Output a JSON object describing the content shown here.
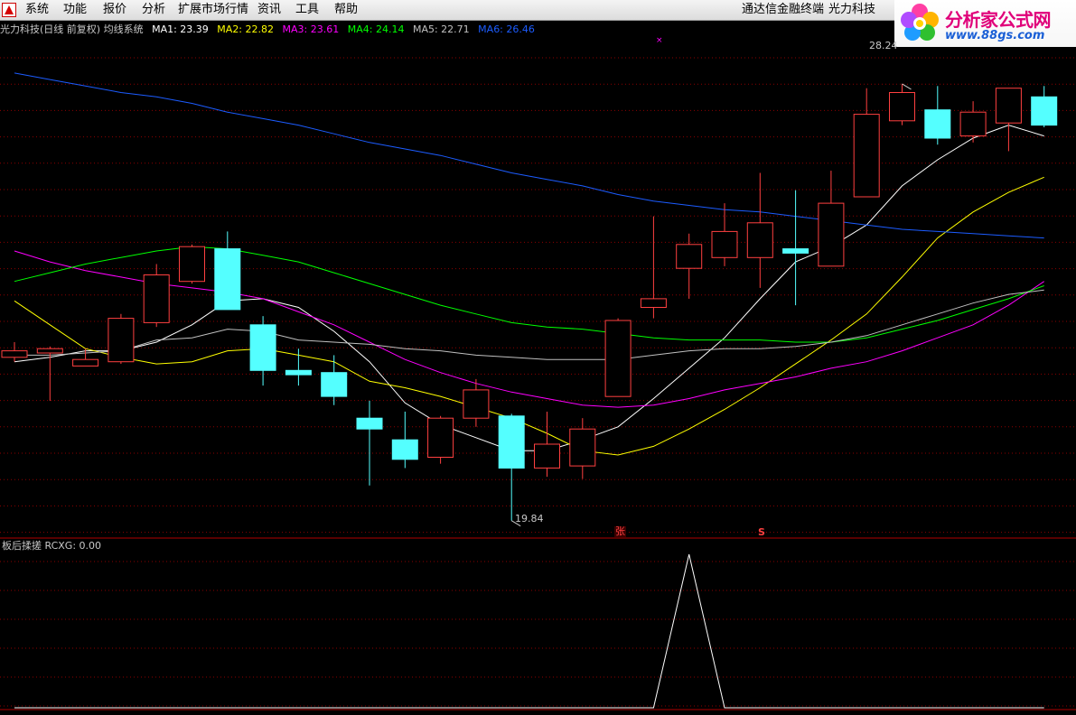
{
  "menu": {
    "items": [
      "系统",
      "功能",
      "报价",
      "分析",
      "扩展市场行情",
      "资讯",
      "工具",
      "帮助"
    ],
    "right_items": [
      "通达信金融终端",
      "光力科技"
    ]
  },
  "logo": {
    "title": "分析家公式网",
    "url": "www.88gs.com"
  },
  "info": {
    "stock": "光力科技(日线 前复权) 均线系统",
    "ma": [
      {
        "label": "MA1: 23.39",
        "color": "#ffffff"
      },
      {
        "label": "MA2: 22.82",
        "color": "#ffff00"
      },
      {
        "label": "MA3: 23.61",
        "color": "#ff00ff"
      },
      {
        "label": "MA4: 24.14",
        "color": "#00ff00"
      },
      {
        "label": "MA5: 22.71",
        "color": "#c0c0c0"
      },
      {
        "label": "MA6: 26.46",
        "color": "#1c5cff"
      }
    ]
  },
  "price_markers": {
    "high": "28.24",
    "low": "19.84"
  },
  "signals": {
    "zhang": "张",
    "s": "S"
  },
  "sub_indicator": {
    "label": "板后揉搓 RCXG: 0.00"
  },
  "colors": {
    "up": "#ff4040",
    "down": "#54ffff",
    "grid": "#8b0000",
    "background": "#000000"
  },
  "chart_data": {
    "type": "candlestick",
    "candles": [
      {
        "o": 23.6,
        "c": 23.75,
        "h": 23.95,
        "l": 23.5
      },
      {
        "o": 23.7,
        "c": 23.8,
        "h": 23.85,
        "l": 22.6
      },
      {
        "o": 23.4,
        "c": 23.55,
        "h": 23.8,
        "l": 23.4
      },
      {
        "o": 23.5,
        "c": 24.5,
        "h": 24.6,
        "l": 23.45
      },
      {
        "o": 24.4,
        "c": 25.5,
        "h": 25.75,
        "l": 24.3
      },
      {
        "o": 25.35,
        "c": 26.15,
        "h": 26.2,
        "l": 25.3
      },
      {
        "o": 26.1,
        "c": 24.7,
        "h": 26.5,
        "l": 24.7
      },
      {
        "o": 24.35,
        "c": 23.3,
        "h": 24.55,
        "l": 22.95
      },
      {
        "o": 23.3,
        "c": 23.2,
        "h": 23.8,
        "l": 22.95
      },
      {
        "o": 23.25,
        "c": 22.7,
        "h": 23.65,
        "l": 22.5
      },
      {
        "o": 22.2,
        "c": 21.95,
        "h": 22.6,
        "l": 20.65
      },
      {
        "o": 21.7,
        "c": 21.25,
        "h": 22.35,
        "l": 21.05
      },
      {
        "o": 21.3,
        "c": 22.2,
        "h": 22.25,
        "l": 21.15
      },
      {
        "o": 22.2,
        "c": 22.85,
        "h": 23.1,
        "l": 22.0
      },
      {
        "o": 22.25,
        "c": 21.05,
        "h": 22.3,
        "l": 19.84
      },
      {
        "o": 21.05,
        "c": 21.6,
        "h": 22.35,
        "l": 20.85
      },
      {
        "o": 21.1,
        "c": 21.95,
        "h": 22.2,
        "l": 20.8
      },
      {
        "o": 22.7,
        "c": 24.45,
        "h": 24.5,
        "l": 22.7
      },
      {
        "o": 24.75,
        "c": 24.95,
        "h": 26.85,
        "l": 24.5
      },
      {
        "o": 25.65,
        "c": 26.2,
        "h": 26.45,
        "l": 24.95
      },
      {
        "o": 25.9,
        "c": 26.5,
        "h": 27.15,
        "l": 25.7
      },
      {
        "o": 25.9,
        "c": 26.7,
        "h": 27.85,
        "l": 25.2
      },
      {
        "o": 26.1,
        "c": 26.0,
        "h": 27.45,
        "l": 24.8
      },
      {
        "o": 25.7,
        "c": 27.15,
        "h": 27.9,
        "l": 25.7
      },
      {
        "o": 27.3,
        "c": 29.2,
        "h": 29.8,
        "l": 27.3
      },
      {
        "o": 29.05,
        "c": 29.7,
        "h": 29.9,
        "l": 28.95
      },
      {
        "o": 29.3,
        "c": 28.65,
        "h": 29.85,
        "l": 28.5
      },
      {
        "o": 28.7,
        "c": 29.25,
        "h": 29.5,
        "l": 28.55
      },
      {
        "o": 29.0,
        "c": 29.8,
        "h": 29.8,
        "l": 28.35
      },
      {
        "o": 29.6,
        "c": 28.95,
        "h": 29.85,
        "l": 28.9
      }
    ],
    "ma_series": [
      {
        "name": "MA1",
        "color": "#ffffff",
        "values": [
          23.5,
          23.6,
          23.75,
          23.75,
          23.95,
          24.35,
          24.9,
          24.95,
          24.75,
          24.2,
          23.5,
          22.55,
          22.05,
          21.75,
          21.45,
          21.45,
          21.7,
          22.0,
          22.65,
          23.35,
          24.05,
          24.95,
          25.8,
          26.15,
          26.65,
          27.55,
          28.15,
          28.65,
          28.95,
          28.7
        ]
      },
      {
        "name": "MA2",
        "color": "#ffff00",
        "values": [
          24.9,
          24.35,
          23.8,
          23.6,
          23.45,
          23.5,
          23.75,
          23.8,
          23.65,
          23.5,
          23.05,
          22.9,
          22.7,
          22.45,
          22.2,
          21.85,
          21.45,
          21.35,
          21.55,
          21.95,
          22.4,
          22.9,
          23.45,
          24.0,
          24.6,
          25.45,
          26.35,
          26.95,
          27.4,
          27.75
        ]
      },
      {
        "name": "MA3",
        "color": "#ff00ff",
        "values": [
          26.05,
          25.8,
          25.6,
          25.45,
          25.3,
          25.2,
          25.1,
          24.95,
          24.65,
          24.35,
          23.95,
          23.55,
          23.25,
          23.0,
          22.8,
          22.65,
          22.5,
          22.45,
          22.5,
          22.65,
          22.85,
          23.0,
          23.15,
          23.35,
          23.5,
          23.75,
          24.05,
          24.35,
          24.8,
          25.35
        ]
      },
      {
        "name": "MA4",
        "color": "#00ff00",
        "values": [
          25.35,
          25.55,
          25.75,
          25.9,
          26.05,
          26.15,
          26.1,
          25.95,
          25.8,
          25.55,
          25.3,
          25.05,
          24.8,
          24.6,
          24.4,
          24.3,
          24.25,
          24.15,
          24.05,
          24.0,
          24.0,
          24.0,
          23.95,
          23.95,
          24.05,
          24.25,
          24.45,
          24.7,
          24.95,
          25.25
        ]
      },
      {
        "name": "MA5",
        "color": "#c0c0c0",
        "values": [
          23.65,
          23.65,
          23.7,
          23.75,
          24.0,
          24.05,
          24.25,
          24.2,
          24.0,
          23.95,
          23.9,
          23.8,
          23.75,
          23.65,
          23.6,
          23.55,
          23.55,
          23.55,
          23.65,
          23.75,
          23.8,
          23.8,
          23.85,
          23.95,
          24.1,
          24.35,
          24.6,
          24.85,
          25.05,
          25.15
        ]
      },
      {
        "name": "MA6",
        "color": "#1c5cff",
        "values": [
          30.15,
          30.0,
          29.85,
          29.7,
          29.6,
          29.45,
          29.25,
          29.1,
          28.95,
          28.75,
          28.55,
          28.4,
          28.25,
          28.05,
          27.85,
          27.7,
          27.55,
          27.35,
          27.2,
          27.1,
          27.0,
          26.95,
          26.85,
          26.75,
          26.65,
          26.55,
          26.5,
          26.45,
          26.4,
          26.35
        ]
      }
    ],
    "sub_series": {
      "name": "RCXG",
      "values": [
        0,
        0,
        0,
        0,
        0,
        0,
        0,
        0,
        0,
        0,
        0,
        0,
        0,
        0,
        0,
        0,
        0,
        0,
        0,
        1,
        0,
        0,
        0,
        0,
        0,
        0,
        0,
        0,
        0,
        0
      ]
    },
    "price_range": [
      19.5,
      31.0
    ],
    "signal_positions": {
      "zhang": 17,
      "s": 21
    }
  }
}
